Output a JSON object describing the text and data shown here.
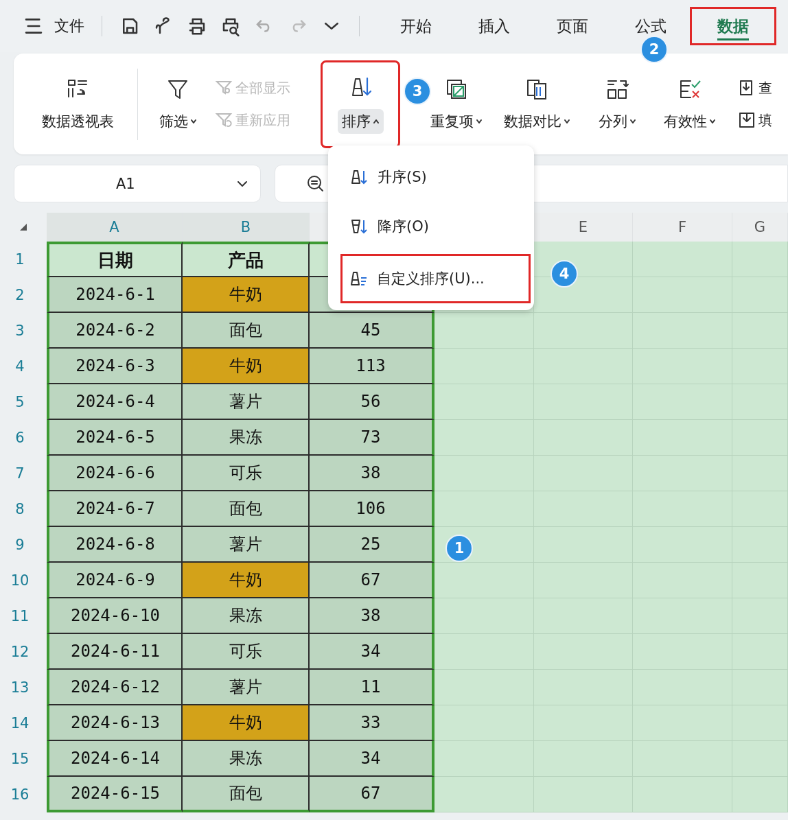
{
  "menu": {
    "file": "文件"
  },
  "tabs": [
    {
      "label": "开始",
      "selected": false,
      "outlined": false
    },
    {
      "label": "插入",
      "selected": false,
      "outlined": false
    },
    {
      "label": "页面",
      "selected": false,
      "outlined": false
    },
    {
      "label": "公式",
      "selected": false,
      "outlined": false
    },
    {
      "label": "数据",
      "selected": true,
      "outlined": true,
      "badge": "2"
    }
  ],
  "ribbon": [
    {
      "kind": "large",
      "label": "数据透视表",
      "dropdown": false,
      "selected": false,
      "outlined": false
    },
    {
      "kind": "large",
      "label": "筛选",
      "dropdown": true,
      "selected": false,
      "outlined": false
    },
    {
      "kind": "stack",
      "items": [
        {
          "label": "全部显示",
          "disabled": true
        },
        {
          "label": "重新应用",
          "disabled": true
        }
      ]
    },
    {
      "kind": "large",
      "label": "排序",
      "dropdown": true,
      "selected": true,
      "outlined": true,
      "badge": "3"
    },
    {
      "kind": "large",
      "label": "重复项",
      "dropdown": true,
      "selected": false,
      "outlined": false
    },
    {
      "kind": "large",
      "label": "数据对比",
      "dropdown": true,
      "selected": false,
      "outlined": false
    },
    {
      "kind": "large",
      "label": "分列",
      "dropdown": true,
      "selected": false,
      "outlined": false
    },
    {
      "kind": "large",
      "label": "有效性",
      "dropdown": true,
      "selected": false,
      "outlined": false
    },
    {
      "kind": "stack",
      "items": [
        {
          "label": "查",
          "disabled": false
        },
        {
          "label": "填",
          "disabled": false
        }
      ]
    }
  ],
  "name_box": {
    "value": "A1"
  },
  "sort_menu": {
    "items": [
      {
        "label": "升序(S)",
        "outlined": false
      },
      {
        "label": "降序(O)",
        "outlined": false
      },
      {
        "label": "自定义排序(U)...",
        "outlined": true,
        "badge": "4"
      }
    ]
  },
  "sheet": {
    "badge": "1",
    "columns": [
      {
        "label": "A",
        "selected": true
      },
      {
        "label": "B",
        "selected": true
      },
      {},
      {},
      {
        "label": "E",
        "selected": false
      },
      {
        "label": "F",
        "selected": false
      },
      {
        "label": "G",
        "selected": false
      }
    ],
    "rows": [
      {
        "number": "1",
        "cells": [
          {
            "text": "日期",
            "highlighted": false
          },
          {
            "text": "产品",
            "highlighted": false
          },
          {}
        ]
      },
      {
        "number": "2",
        "cells": [
          {
            "text": "2024-6-1",
            "highlighted": false
          },
          {
            "text": "牛奶",
            "highlighted": true
          },
          {}
        ]
      },
      {
        "number": "3",
        "cells": [
          {
            "text": "2024-6-2",
            "highlighted": false
          },
          {
            "text": "面包",
            "highlighted": false
          },
          {
            "text": "45",
            "highlighted": false
          }
        ]
      },
      {
        "number": "4",
        "cells": [
          {
            "text": "2024-6-3",
            "highlighted": false
          },
          {
            "text": "牛奶",
            "highlighted": true
          },
          {
            "text": "113",
            "highlighted": false
          }
        ]
      },
      {
        "number": "5",
        "cells": [
          {
            "text": "2024-6-4",
            "highlighted": false
          },
          {
            "text": "薯片",
            "highlighted": false
          },
          {
            "text": "56",
            "highlighted": false
          }
        ]
      },
      {
        "number": "6",
        "cells": [
          {
            "text": "2024-6-5",
            "highlighted": false
          },
          {
            "text": "果冻",
            "highlighted": false
          },
          {
            "text": "73",
            "highlighted": false
          }
        ]
      },
      {
        "number": "7",
        "cells": [
          {
            "text": "2024-6-6",
            "highlighted": false
          },
          {
            "text": "可乐",
            "highlighted": false
          },
          {
            "text": "38",
            "highlighted": false
          }
        ]
      },
      {
        "number": "8",
        "cells": [
          {
            "text": "2024-6-7",
            "highlighted": false
          },
          {
            "text": "面包",
            "highlighted": false
          },
          {
            "text": "106",
            "highlighted": false
          }
        ]
      },
      {
        "number": "9",
        "cells": [
          {
            "text": "2024-6-8",
            "highlighted": false
          },
          {
            "text": "薯片",
            "highlighted": false
          },
          {
            "text": "25",
            "highlighted": false
          }
        ]
      },
      {
        "number": "10",
        "cells": [
          {
            "text": "2024-6-9",
            "highlighted": false
          },
          {
            "text": "牛奶",
            "highlighted": true
          },
          {
            "text": "67",
            "highlighted": false
          }
        ]
      },
      {
        "number": "11",
        "cells": [
          {
            "text": "2024-6-10",
            "highlighted": false
          },
          {
            "text": "果冻",
            "highlighted": false
          },
          {
            "text": "38",
            "highlighted": false
          }
        ]
      },
      {
        "number": "12",
        "cells": [
          {
            "text": "2024-6-11",
            "highlighted": false
          },
          {
            "text": "可乐",
            "highlighted": false
          },
          {
            "text": "34",
            "highlighted": false
          }
        ]
      },
      {
        "number": "13",
        "cells": [
          {
            "text": "2024-6-12",
            "highlighted": false
          },
          {
            "text": "薯片",
            "highlighted": false
          },
          {
            "text": "11",
            "highlighted": false
          }
        ]
      },
      {
        "number": "14",
        "cells": [
          {
            "text": "2024-6-13",
            "highlighted": false
          },
          {
            "text": "牛奶",
            "highlighted": true
          },
          {
            "text": "33",
            "highlighted": false
          }
        ]
      },
      {
        "number": "15",
        "cells": [
          {
            "text": "2024-6-14",
            "highlighted": false
          },
          {
            "text": "果冻",
            "highlighted": false
          },
          {
            "text": "34",
            "highlighted": false
          }
        ]
      },
      {
        "number": "16",
        "cells": [
          {
            "text": "2024-6-15",
            "highlighted": false
          },
          {
            "text": "面包",
            "highlighted": false
          },
          {
            "text": "67",
            "highlighted": false
          }
        ]
      }
    ]
  }
}
